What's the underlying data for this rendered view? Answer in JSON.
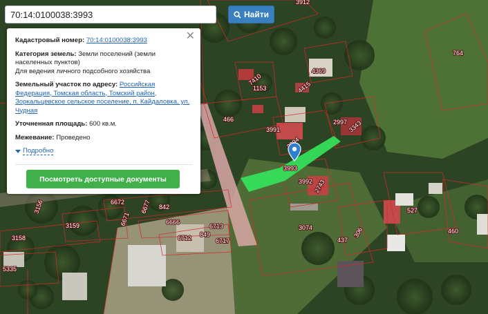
{
  "search": {
    "value": "70:14:0100038:3993",
    "button_label": "Найти"
  },
  "popup": {
    "cadastral_label": "Кадастровый номер:",
    "cadastral_number": "70:14:0100038:3993",
    "category_label": "Категория земель:",
    "category_value": "Земли поселений (земли населенных пунктов)",
    "usage": "Для ведения личного подсобного хозяйства",
    "address_label": "Земельный участок по адресу:",
    "address_value": "Российская Федерация, Томская область, Томский район, Зоркальцевское сельское поселение, п. Кайдаловка, ул. Чудная",
    "area_label": "Уточненная площадь:",
    "area_value": "600 кв.м.",
    "survey_label": "Межевание:",
    "survey_value": "Проведено",
    "more_link": "Подробно",
    "docs_button": "Посмотреть доступные документы"
  },
  "map": {
    "selected_parcel_label": "3993",
    "parcel_labels": [
      "764",
      "3912",
      "4369",
      "4415",
      "1153",
      "7410",
      "466",
      "3991",
      "2997",
      "3343",
      "3994",
      "3992",
      "2743",
      "3156",
      "6672",
      "6671",
      "6677",
      "842",
      "6666",
      "6713",
      "6712",
      "849",
      "6717",
      "3158",
      "3159",
      "3074",
      "437",
      "306",
      "527",
      "460",
      "5335"
    ],
    "colors": {
      "selected_fill": "#35e35c",
      "boundary": "#d42a2a",
      "road": "#d9a7a7"
    }
  }
}
